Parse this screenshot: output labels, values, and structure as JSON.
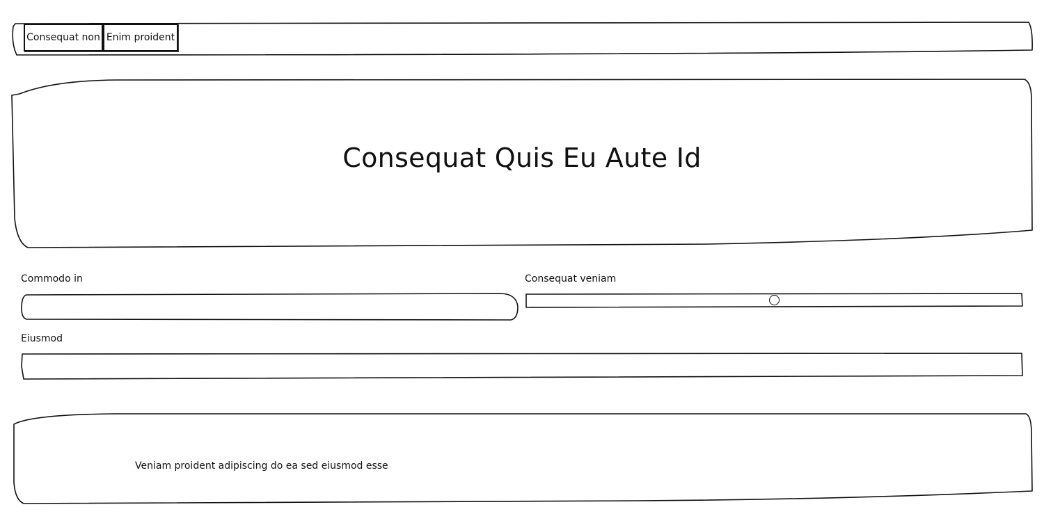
{
  "navbar": {
    "items": [
      {
        "label": "Consequat non"
      },
      {
        "label": "Enim proident"
      }
    ]
  },
  "hero": {
    "title": "Consequat Quis Eu Aute Id"
  },
  "form": {
    "commodo": {
      "label": "Commodo in",
      "value": "",
      "placeholder": ""
    },
    "consequat": {
      "label": "Consequat veniam",
      "value_fraction": 0.5
    },
    "eiusmod": {
      "label": "Eiusmod",
      "value": "",
      "placeholder": ""
    }
  },
  "panel": {
    "text": "Veniam proident adipiscing do ea sed eiusmod esse"
  }
}
